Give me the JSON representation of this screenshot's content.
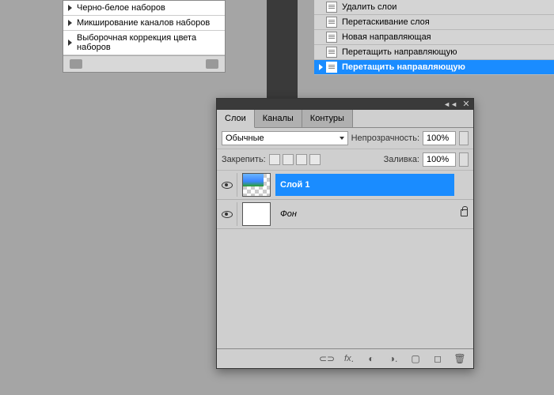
{
  "adjustments": {
    "items": [
      "Черно-белое наборов",
      "Микширование каналов наборов",
      "Выборочная коррекция цвета наборов"
    ]
  },
  "history": {
    "items": [
      {
        "label": "Удалить слои",
        "selected": false
      },
      {
        "label": "Перетаскивание слоя",
        "selected": false
      },
      {
        "label": "Новая направляющая",
        "selected": false
      },
      {
        "label": "Перетащить направляющую",
        "selected": false
      },
      {
        "label": "Перетащить направляющую",
        "selected": true
      }
    ]
  },
  "panel": {
    "tabs": {
      "layers": "Слои",
      "channels": "Каналы",
      "paths": "Контуры"
    },
    "blend_mode": "Обычные",
    "opacity_label": "Непрозрачность:",
    "opacity_value": "100%",
    "lock_label": "Закрепить:",
    "fill_label": "Заливка:",
    "fill_value": "100%",
    "layers": [
      {
        "name": "Слой 1",
        "selected": true,
        "locked": false,
        "visible": true,
        "thumb": "image"
      },
      {
        "name": "Фон",
        "selected": false,
        "locked": true,
        "visible": true,
        "thumb": "white"
      }
    ],
    "footer_icons": [
      "link",
      "fx",
      "mask",
      "adjustment",
      "group",
      "new",
      "trash"
    ]
  }
}
